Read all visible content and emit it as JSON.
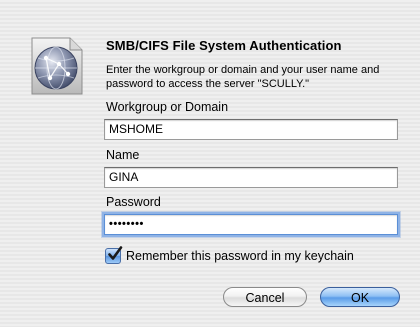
{
  "dialog": {
    "title": "SMB/CIFS File System Authentication",
    "message": "Enter the workgroup or domain and your user name and password to access the server \"SCULLY.\"",
    "icon": "network-globe-icon"
  },
  "fields": {
    "workgroup": {
      "label": "Workgroup or Domain",
      "value": "MSHOME"
    },
    "name": {
      "label": "Name",
      "value": "GINA"
    },
    "password": {
      "label": "Password",
      "value": "••••••••"
    }
  },
  "remember": {
    "label": "Remember this password in my keychain",
    "checked": true
  },
  "buttons": {
    "cancel": "Cancel",
    "ok": "OK"
  },
  "colors": {
    "focus_ring": "#8fb3e6",
    "default_button": "#5a9ce8"
  }
}
